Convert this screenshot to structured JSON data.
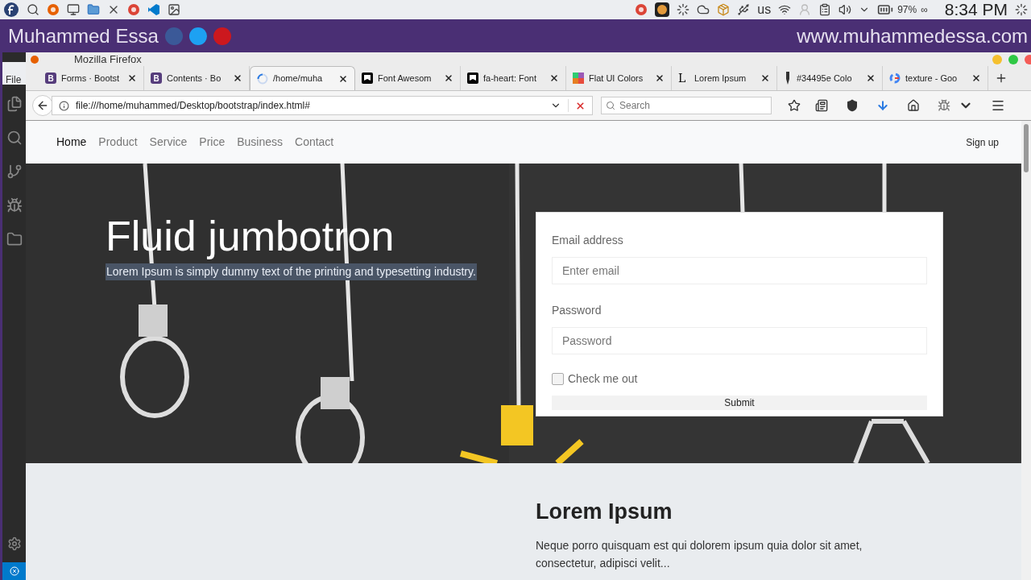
{
  "taskbar": {
    "keyboard": "us",
    "battery": "97%",
    "battery_mode": "∞",
    "clock": "8:34 PM"
  },
  "banner": {
    "name": "Muhammed Essa",
    "website": "www.muhammedessa.com"
  },
  "background_window": {
    "menu": "File"
  },
  "window": {
    "title": "Mozilla Firefox",
    "tabs": [
      {
        "label": "Forms · Bootst",
        "selected": false,
        "favicon": {
          "kind": "letter",
          "text": "B"
        }
      },
      {
        "label": "Contents · Bo",
        "selected": false,
        "favicon": {
          "kind": "letter",
          "text": "B"
        }
      },
      {
        "label": "/home/muha",
        "selected": true,
        "favicon": {
          "kind": "spinner"
        }
      },
      {
        "label": "Font Awesom",
        "selected": false,
        "favicon": {
          "kind": "flag"
        }
      },
      {
        "label": "fa-heart: Font",
        "selected": false,
        "favicon": {
          "kind": "flag"
        }
      },
      {
        "label": "Flat UI Colors",
        "selected": false,
        "favicon": {
          "kind": "grid"
        }
      },
      {
        "label": "Lorem Ipsum",
        "selected": false,
        "favicon": {
          "kind": "plain",
          "text": "L"
        }
      },
      {
        "label": "#34495e Colo",
        "selected": false,
        "favicon": {
          "kind": "pen"
        }
      },
      {
        "label": "texture - Goo",
        "selected": false,
        "favicon": {
          "kind": "ring"
        }
      }
    ],
    "address": "file:///home/muhammed/Desktop/bootstrap/index.html#",
    "search": {
      "placeholder": "Search"
    }
  },
  "page": {
    "nav": {
      "items": [
        {
          "label": "Home",
          "selected": true
        },
        {
          "label": "Product",
          "selected": false
        },
        {
          "label": "Service",
          "selected": false
        },
        {
          "label": "Price",
          "selected": false
        },
        {
          "label": "Business",
          "selected": false
        },
        {
          "label": "Contact",
          "selected": false
        }
      ],
      "signup": "Sign up"
    },
    "hero": {
      "title": "Fluid jumbotron",
      "lead": "Lorem Ipsum is simply dummy text of the printing and typesetting industry.",
      "lead_selected": true
    },
    "form": {
      "email_label": "Email address",
      "email_placeholder": "Enter email",
      "password_label": "Password",
      "password_placeholder": "Password",
      "check_label": "Check me out",
      "checked": false,
      "submit": "Submit"
    },
    "section": {
      "heading": "Lorem Ipsum",
      "text": "Neque porro quisquam est qui dolorem ipsum quia dolor sit amet, consectetur, adipisci velit..."
    }
  }
}
